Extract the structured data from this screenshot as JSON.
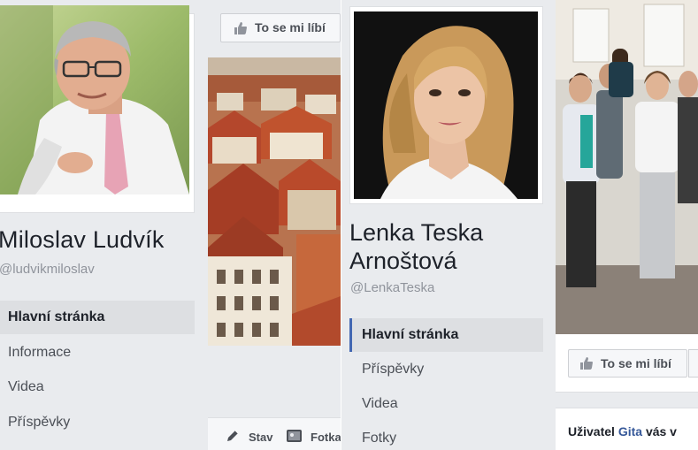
{
  "left_profile": {
    "name": "Miloslav Ludvík",
    "handle": "@ludvikmiloslav",
    "nav": [
      "Hlavní stránka",
      "Informace",
      "Videa",
      "Příspěvky"
    ]
  },
  "center": {
    "like_label": "To se mi líbí",
    "status_label": "Stav",
    "photo_label": "Fotka"
  },
  "right_profile": {
    "name": "Lenka Teska Arnoštová",
    "handle": "@LenkaTeska",
    "nav": [
      "Hlavní stránka",
      "Příspěvky",
      "Videa",
      "Fotky"
    ]
  },
  "far_right": {
    "like_label": "To se mi líbí",
    "invite_prefix": "Uživatel",
    "invite_name": "Gita",
    "invite_suffix": "vás v"
  },
  "colors": {
    "page_bg": "#e9ebee",
    "active_nav_bg": "#dddfe2",
    "link": "#365899",
    "accent": "#4267b2"
  }
}
